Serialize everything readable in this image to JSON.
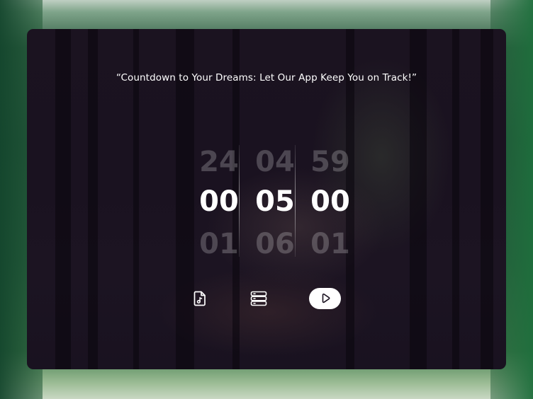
{
  "quote": "“Countdown to Your Dreams: Let Our App Keep You on Track!”",
  "timer": {
    "hours": {
      "prev": "24",
      "current": "00",
      "next": "01"
    },
    "minutes": {
      "prev": "04",
      "current": "05",
      "next": "06"
    },
    "seconds": {
      "prev": "59",
      "current": "00",
      "next": "01"
    }
  },
  "controls": {
    "music": {
      "icon": "music-file-icon"
    },
    "list": {
      "icon": "list-stack-icon"
    },
    "play": {
      "icon": "play-icon"
    }
  },
  "colors": {
    "card_bg": "#1a1220",
    "text": "#ffffff",
    "play_button_bg": "#ffffff"
  }
}
